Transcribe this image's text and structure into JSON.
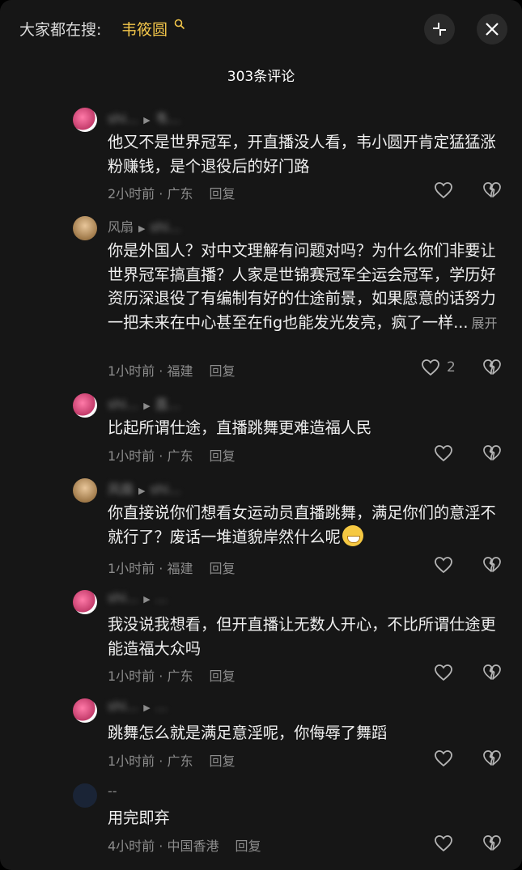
{
  "header": {
    "search_prefix": "大家都在搜:",
    "search_term": "韦筱圆",
    "comment_count": "303条评论"
  },
  "comments": [
    {
      "user": "shi...",
      "reply_to": "韦...",
      "text": "他又不是世界冠军，开直播没人看，韦小圆开肯定猛猛涨粉赚钱，是个退役后的好门路",
      "time_location": "2小时前 · 广东",
      "reply_label": "回复",
      "likes": ""
    },
    {
      "user": "风扇",
      "reply_to": "shi...",
      "text": "你是外国人？对中文理解有问题对吗？为什么你们非要让世界冠军搞直播？人家是世锦赛冠军全运会冠军，学历好资历深退役了有编制有好的仕途前景，如果愿意的话努力一把未来在中心甚至在fig也能发光发亮，疯了一样...",
      "expand_label": "展开",
      "time_location": "1小时前 · 福建",
      "reply_label": "回复",
      "likes": "2"
    },
    {
      "user": "shi...",
      "reply_to": "直...",
      "text": "比起所谓仕途，直播跳舞更难造福人民",
      "time_location": "1小时前 · 广东",
      "reply_label": "回复",
      "likes": ""
    },
    {
      "user": "风扇",
      "reply_to": "shi...",
      "text": "你直接说你们想看女运动员直播跳舞，满足你们的意淫不就行了？废话一堆道貌岸然什么呢",
      "time_location": "1小时前 · 福建",
      "reply_label": "回复",
      "likes": ""
    },
    {
      "user": "shi...",
      "reply_to": "...",
      "text": "我没说我想看，但开直播让无数人开心，不比所谓仕途更能造福大众吗",
      "time_location": "1小时前 · 广东",
      "reply_label": "回复",
      "likes": ""
    },
    {
      "user": "shi...",
      "reply_to": "...",
      "text": "跳舞怎么就是满足意淫呢，你侮辱了舞蹈",
      "time_location": "1小时前 · 广东",
      "reply_label": "回复",
      "likes": ""
    },
    {
      "user": "--",
      "reply_to": "",
      "text": "用完即弃",
      "time_location": "4小时前 · 中国香港",
      "reply_label": "回复",
      "likes": ""
    }
  ],
  "icons": {
    "search_term_icon": "search-icon",
    "collapse": "collapse-icon",
    "close": "close-icon",
    "like": "heart-outline-icon",
    "dislike": "broken-heart-icon",
    "emoji": "grinning-sweat-emoji"
  },
  "colors": {
    "accent": "#f3c64a",
    "background": "#161616"
  }
}
